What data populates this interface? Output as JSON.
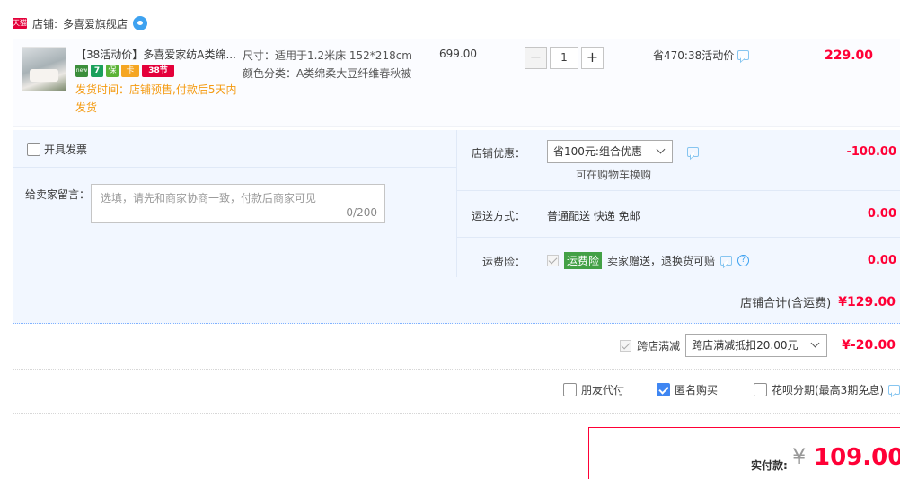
{
  "store": {
    "badge": "天猫",
    "label": "店铺:",
    "name": "多喜爱旗舰店"
  },
  "item": {
    "title": "【38活动价】多喜爱家纺A类绵...",
    "badges": [
      "new",
      "7",
      "保",
      "卡",
      "38节"
    ],
    "ship_time": "发货时间：店铺预售,付款后5天内发货",
    "sku_size": "尺寸：适用于1.2米床 152*218cm",
    "sku_color": "颜色分类：A类绵柔大豆纤维春秋被",
    "original_price": "699.00",
    "quantity": "1",
    "minus": "−",
    "plus": "+",
    "promo_note": "省470:38活动价",
    "final_price": "229.00"
  },
  "options": {
    "invoice_label": "开具发票",
    "message_label": "给卖家留言：",
    "message_placeholder": "选填，请先和商家协商一致，付款后商家可见",
    "message_count": "0/200",
    "store_discount_label": "店铺优惠：",
    "store_discount_value": "省100元:组合优惠",
    "store_discount_note": "可在购物车换购",
    "store_discount_amount": "-100.00",
    "shipping_label": "运送方式：",
    "shipping_value": "普通配送 快递 免邮",
    "shipping_amount": "0.00",
    "insurance_label": "运费险：",
    "insurance_tag": "运费险",
    "insurance_desc": "卖家赠送，退换货可赔",
    "insurance_amount": "0.00",
    "subtotal_label": "店铺合计(含运费)",
    "subtotal_amount": "¥129.00"
  },
  "cross_store": {
    "label": "跨店满减",
    "select_value": "跨店满减抵扣20.00元",
    "amount": "¥-20.00"
  },
  "checks": {
    "friend_pay": "朋友代付",
    "anonymous": "匿名购买",
    "huabei": "花呗分期(最高3期免息)"
  },
  "pay": {
    "label": "实付款:",
    "currency": "¥",
    "amount": "109.00"
  },
  "colors": {
    "price_red": "#ff0036",
    "accent_blue": "#3f86f2",
    "panel_bg": "#f2f7ff"
  }
}
